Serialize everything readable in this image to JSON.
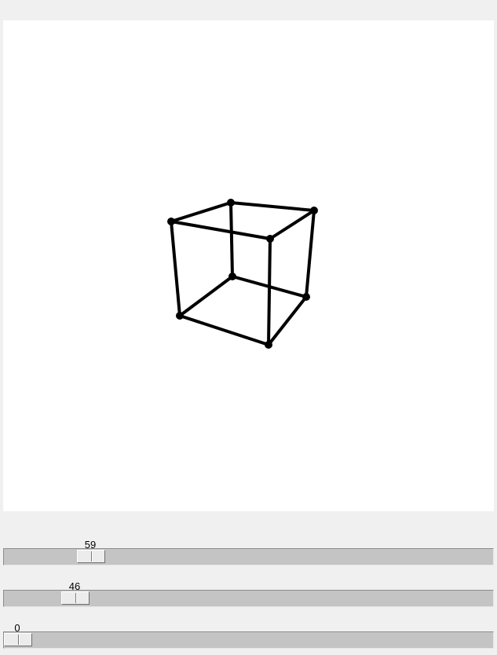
{
  "cube": {
    "edge_color": "#000000",
    "vertex_color": "#000000"
  },
  "sliders": [
    {
      "value": "59",
      "level": 0.159
    },
    {
      "value": "46",
      "level": 0.124
    },
    {
      "value": "0",
      "level": 0.0
    }
  ]
}
